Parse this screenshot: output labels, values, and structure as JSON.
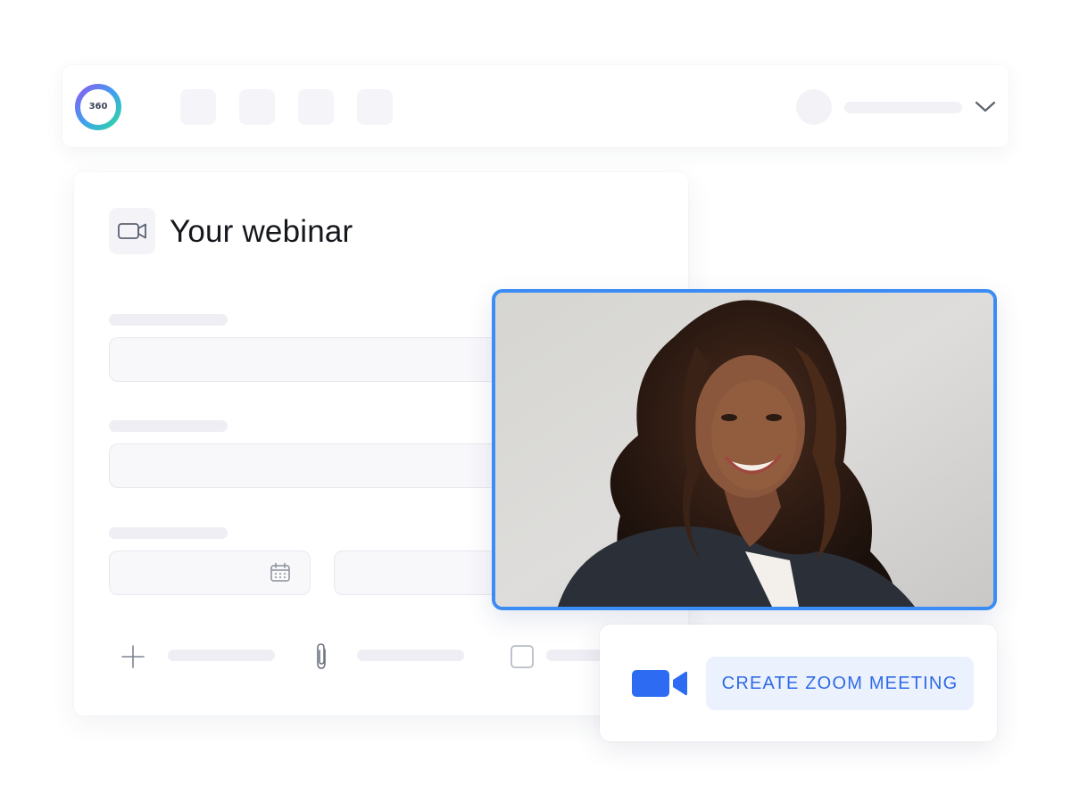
{
  "header": {
    "logo_text": "360"
  },
  "webinar_card": {
    "title": "Your webinar"
  },
  "zoom_panel": {
    "button_label": "CREATE ZOOM MEETING"
  },
  "colors": {
    "accent": "#3b8cf5",
    "zoom_blue": "#2d6bf2",
    "button_bg": "#ebf1fd",
    "button_text": "#2f6ae6"
  },
  "icons": {
    "title_icon": "video-camera-outline-icon",
    "date_icon": "calendar-icon",
    "add_icon": "plus-icon",
    "attach_icon": "paperclip-icon",
    "checkbox_icon": "checkbox-icon",
    "zoom_icon": "video-camera-filled-icon",
    "chevron_icon": "chevron-down-icon"
  }
}
